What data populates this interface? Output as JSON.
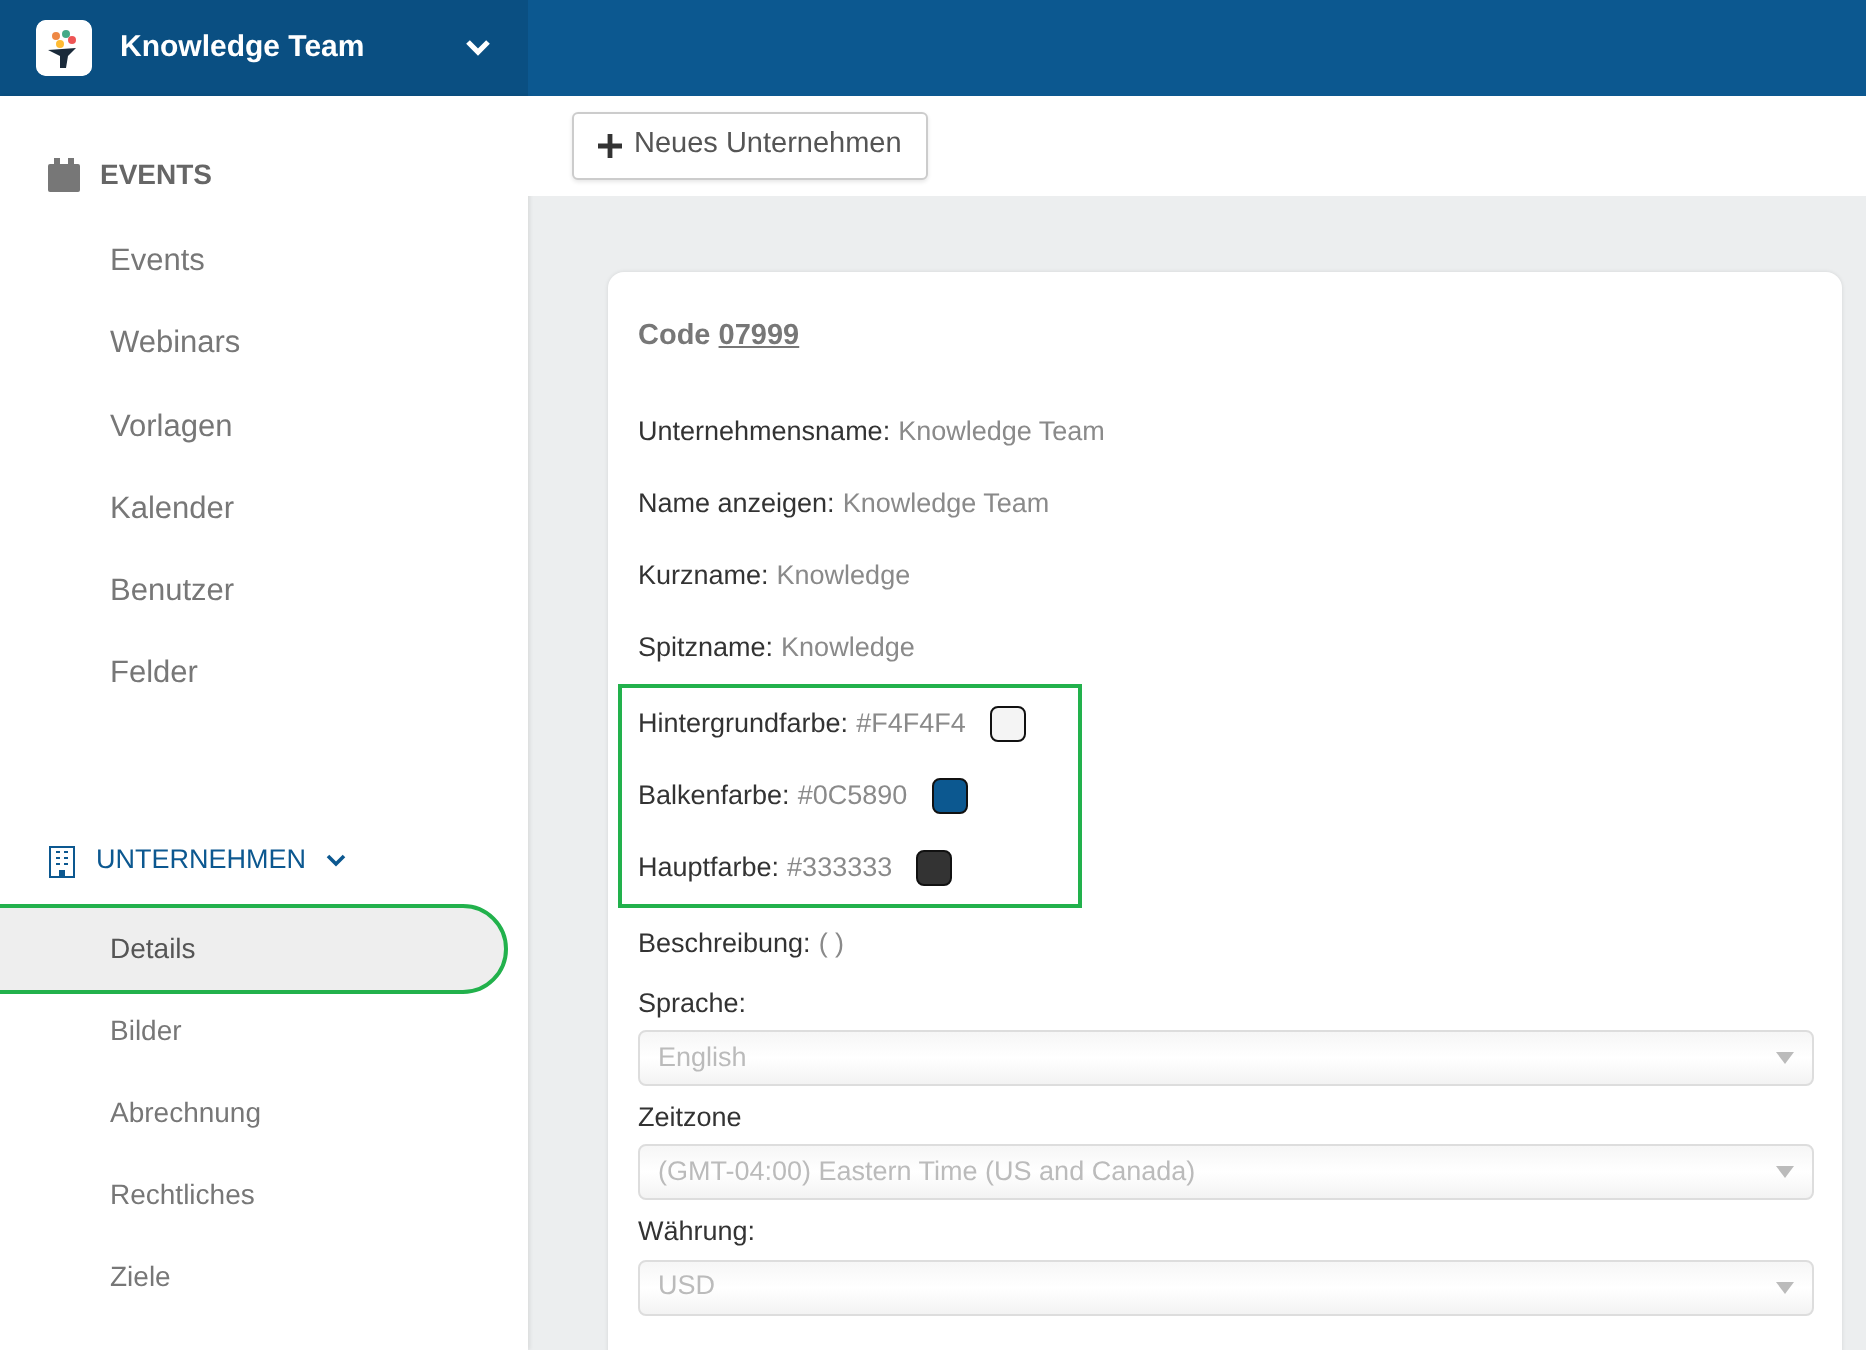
{
  "header": {
    "team_name": "Knowledge Team"
  },
  "sidebar": {
    "sections": [
      {
        "kind": "events",
        "title": "EVENTS",
        "items": [
          {
            "label": "Events",
            "selected": false,
            "highlighted": false
          },
          {
            "label": "Webinars",
            "selected": false,
            "highlighted": false
          },
          {
            "label": "Vorlagen",
            "selected": false,
            "highlighted": false
          },
          {
            "label": "Kalender",
            "selected": false,
            "highlighted": false
          },
          {
            "label": "Benutzer",
            "selected": false,
            "highlighted": false
          },
          {
            "label": "Felder",
            "selected": false,
            "highlighted": false
          }
        ]
      },
      {
        "kind": "company",
        "title": "UNTERNEHMEN",
        "expanded": true,
        "items": [
          {
            "label": "Details",
            "selected": true,
            "highlighted": true
          },
          {
            "label": "Bilder",
            "selected": false,
            "highlighted": false
          },
          {
            "label": "Abrechnung",
            "selected": false,
            "highlighted": false
          },
          {
            "label": "Rechtliches",
            "selected": false,
            "highlighted": false
          },
          {
            "label": "Ziele",
            "selected": false,
            "highlighted": false
          }
        ]
      }
    ]
  },
  "toolbar": {
    "new_button": "Neues Unternehmen"
  },
  "details": {
    "code_label": "Code",
    "code": "07999",
    "fields": [
      {
        "label": "Unternehmensname:",
        "value": "Knowledge Team"
      },
      {
        "label": "Name anzeigen:",
        "value": "Knowledge Team"
      },
      {
        "label": "Kurzname:",
        "value": "Knowledge"
      },
      {
        "label": "Spitzname:",
        "value": "Knowledge"
      }
    ],
    "colors": {
      "highlighted": true,
      "items": [
        {
          "label": "Hintergrundfarbe:",
          "value": "#F4F4F4",
          "color": "#f4f4f4"
        },
        {
          "label": "Balkenfarbe:",
          "value": "#0C5890",
          "color": "#0c5890"
        },
        {
          "label": "Hauptfarbe:",
          "value": "#333333",
          "color": "#333333"
        }
      ]
    },
    "description": {
      "label": "Beschreibung:",
      "value": "( )"
    },
    "selects": [
      {
        "label": "Sprache:",
        "value": "English",
        "disabled": true
      },
      {
        "label": "Zeitzone",
        "value": "(GMT-04:00) Eastern Time (US and Canada)",
        "disabled": true
      },
      {
        "label": "Währung:",
        "value": "USD",
        "disabled": true
      }
    ]
  }
}
